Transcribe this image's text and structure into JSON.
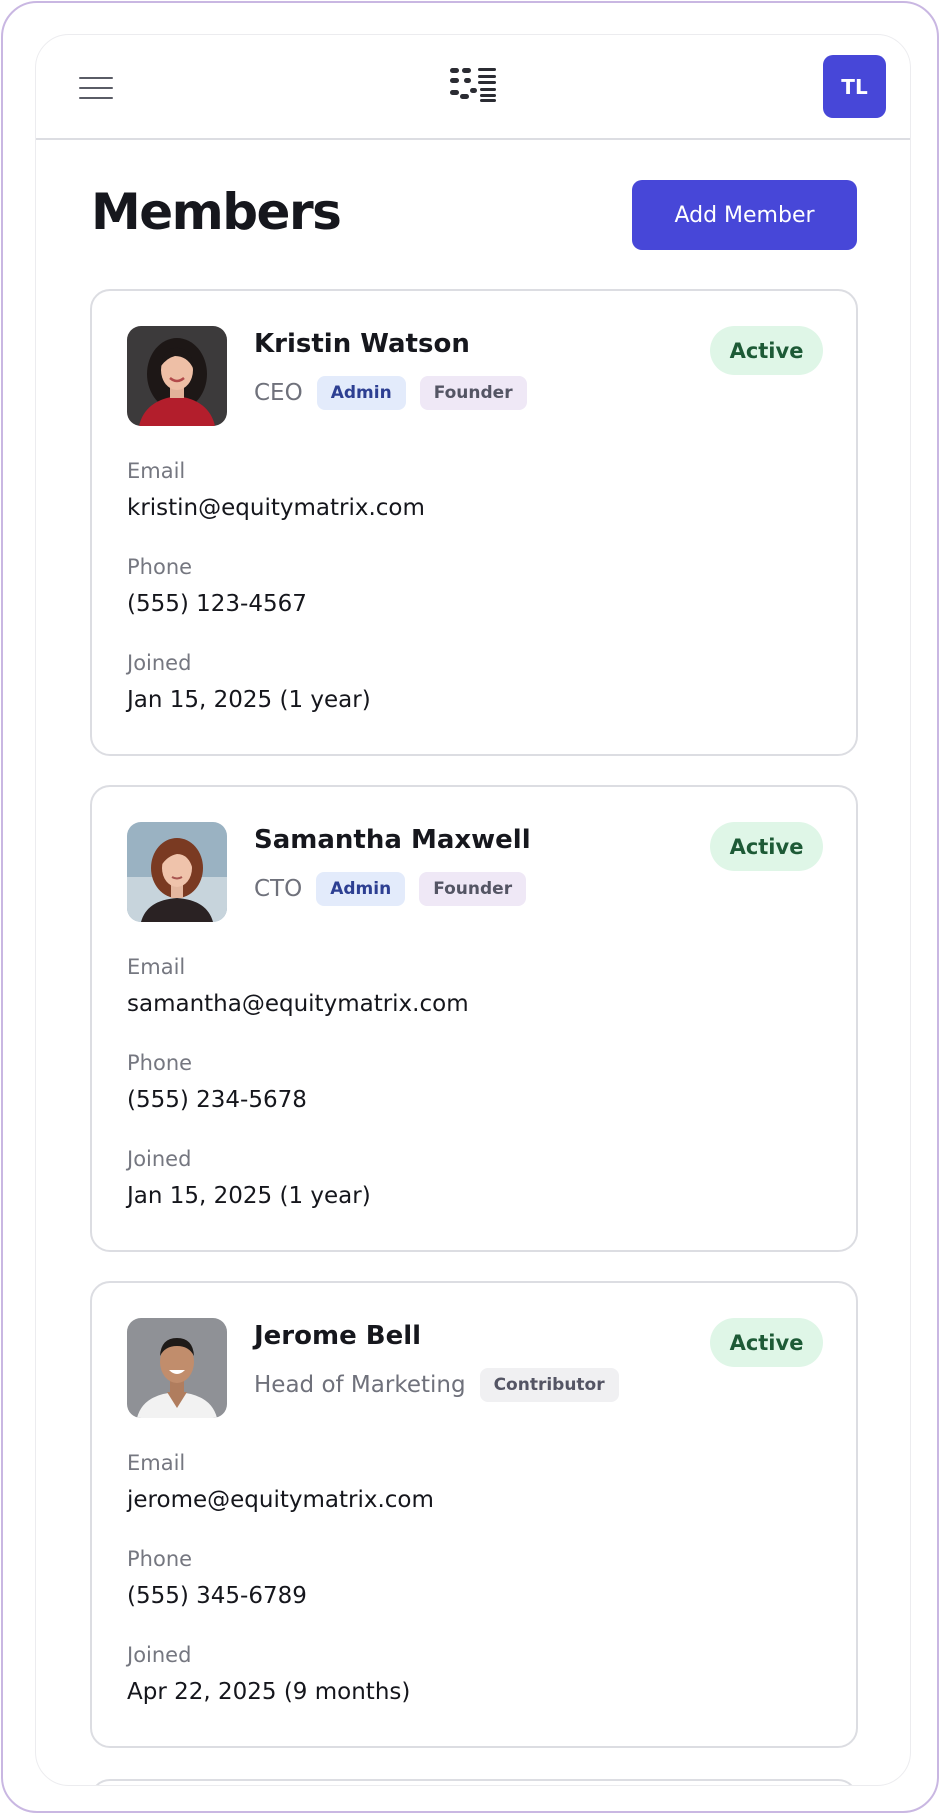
{
  "header": {
    "user_initials": "TL"
  },
  "page": {
    "title": "Members",
    "add_button_label": "Add Member"
  },
  "members": [
    {
      "name": "Kristin Watson",
      "role": "CEO",
      "tags": [
        "Admin",
        "Founder"
      ],
      "status": "Active",
      "email_label": "Email",
      "email": "kristin@equitymatrix.com",
      "phone_label": "Phone",
      "phone": "(555) 123-4567",
      "joined_label": "Joined",
      "joined": "Jan 15, 2025 (1 year)"
    },
    {
      "name": "Samantha Maxwell",
      "role": "CTO",
      "tags": [
        "Admin",
        "Founder"
      ],
      "status": "Active",
      "email_label": "Email",
      "email": "samantha@equitymatrix.com",
      "phone_label": "Phone",
      "phone": "(555) 234-5678",
      "joined_label": "Joined",
      "joined": "Jan 15, 2025 (1 year)"
    },
    {
      "name": "Jerome Bell",
      "role": "Head of Marketing",
      "tags": [
        "Contributor"
      ],
      "status": "Active",
      "email_label": "Email",
      "email": "jerome@equitymatrix.com",
      "phone_label": "Phone",
      "phone": "(555) 345-6789",
      "joined_label": "Joined",
      "joined": "Apr 22, 2025 (9 months)"
    }
  ],
  "icons": {
    "menu": "hamburger-menu-icon",
    "logo": "equity-matrix-logo"
  },
  "colors": {
    "accent": "#4747d8",
    "status_active_bg": "#dff6e7",
    "status_active_text": "#1d5a36",
    "tag_admin_bg": "#e3ebfb",
    "tag_admin_text": "#2d3f92",
    "tag_founder_bg": "#efe8f6",
    "tag_contributor_bg": "#f0f0f2",
    "device_frame": "#c9b7e2"
  }
}
